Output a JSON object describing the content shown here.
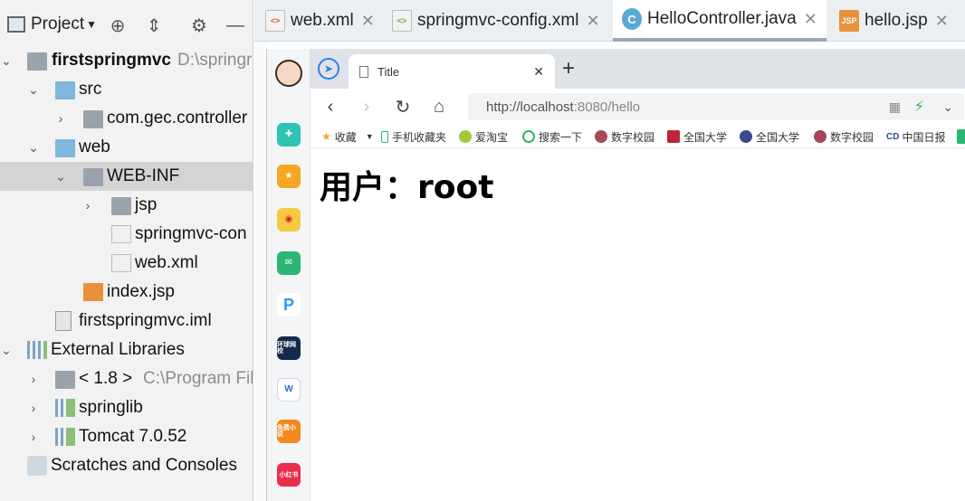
{
  "project_panel": {
    "title": "Project",
    "tree": [
      {
        "label": "firstspringmvc",
        "extra": "D:\\springr",
        "bold": true
      },
      {
        "label": "src"
      },
      {
        "label": "com.gec.controller"
      },
      {
        "label": "web"
      },
      {
        "label": "WEB-INF"
      },
      {
        "label": "jsp"
      },
      {
        "label": "springmvc-con"
      },
      {
        "label": "web.xml"
      },
      {
        "label": "index.jsp"
      },
      {
        "label": "firstspringmvc.iml"
      },
      {
        "label": "External Libraries"
      },
      {
        "label": "< 1.8 >",
        "extra": "C:\\Program Fil"
      },
      {
        "label": "springlib"
      },
      {
        "label": "Tomcat 7.0.52"
      },
      {
        "label": "Scratches and Consoles"
      }
    ]
  },
  "editor_tabs": [
    {
      "label": "web.xml",
      "active": false
    },
    {
      "label": "springmvc-config.xml",
      "active": false
    },
    {
      "label": "HelloController.java",
      "active": true
    },
    {
      "label": "hello.jsp",
      "active": false
    }
  ],
  "browser": {
    "tab_title": "Title",
    "url_host": "http://localhost",
    "url_rest": ":8080/hello",
    "bookmarks": [
      "收藏",
      "手机收藏夹",
      "爱淘宝",
      "搜索一下",
      "数字校园",
      "全国大学",
      "全国大学",
      "数字校园",
      "中国日报"
    ],
    "sidebar_apps": [
      "环球网校",
      "免费小说",
      "小红书"
    ],
    "page_heading": "用户：root",
    "colors": {
      "tabbar": "#dfe3e8",
      "urlbox": "#f1f3f4",
      "accent": "#2b7de9"
    }
  }
}
